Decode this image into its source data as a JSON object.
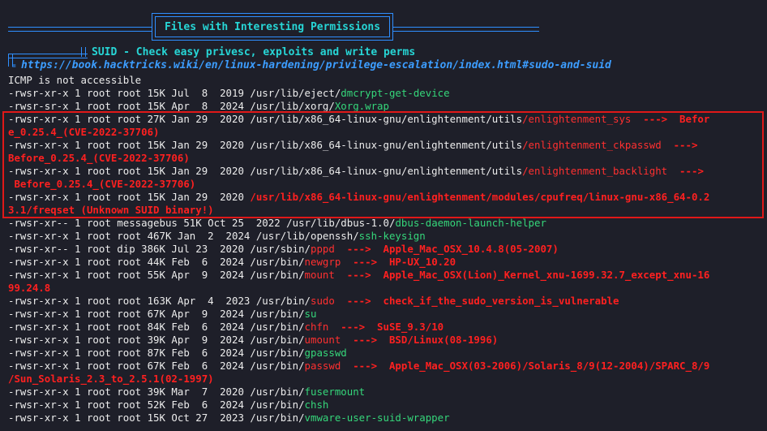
{
  "header": {
    "title": "Files with Interesting Permissions"
  },
  "section": {
    "title": "SUID - Check easy privesc, exploits and write perms",
    "link": "https://book.hacktricks.wiki/en/linux-hardening/privilege-escalation/index.html#sudo-and-suid"
  },
  "lines": [
    "ICMP is not accessible",
    "-rwsr-xr-x 1 root root 15K Jul  8  2019 /usr/lib/eject/",
    "-rwsr-sr-x 1 root root 15K Apr  8  2024 /usr/lib/xorg/",
    "-rwsr-xr-x 1 root root 27K Jan 29  2020 /usr/lib/x86_64-linux-gnu/enlightenment/utils",
    "e_0.25.4_(CVE-2022-37706)",
    "-rwsr-xr-x 1 root root 15K Jan 29  2020 /usr/lib/x86_64-linux-gnu/enlightenment/utils",
    "Before_0.25.4_(CVE-2022-37706)",
    "-rwsr-xr-x 1 root root 15K Jan 29  2020 /usr/lib/x86_64-linux-gnu/enlightenment/utils",
    " Before_0.25.4_(CVE-2022-37706)",
    "-rwsr-xr-x 1 root root 15K Jan 29  2020 ",
    "3.1/freqset (Unknown SUID binary!)",
    "-rwsr-xr-- 1 root messagebus 51K Oct 25  2022 /usr/lib/dbus-1.0/",
    "-rwsr-xr-x 1 root root 467K Jan  2  2024 /usr/lib/openssh/",
    "-rwsr-xr-- 1 root dip 386K Jul 23  2020 /usr/sbin/",
    "-rwsr-xr-x 1 root root 44K Feb  6  2024 /usr/bin/",
    "-rwsr-xr-x 1 root root 55K Apr  9  2024 /usr/bin/",
    "99.24.8",
    "-rwsr-xr-x 1 root root 163K Apr  4  2023 /usr/bin/",
    "-rwsr-xr-x 1 root root 67K Apr  9  2024 /usr/bin/",
    "-rwsr-xr-x 1 root root 84K Feb  6  2024 /usr/bin/",
    "-rwsr-xr-x 1 root root 39K Apr  9  2024 /usr/bin/",
    "-rwsr-xr-x 1 root root 87K Feb  6  2024 /usr/bin/",
    "-rwsr-xr-x 1 root root 67K Feb  6  2024 /usr/bin/",
    "/Sun_Solaris_2.3_to_2.5.1(02-1997)",
    "-rwsr-xr-x 1 root root 39K Mar  7  2020 /usr/bin/",
    "-rwsr-xr-x 1 root root 52K Feb  6  2024 /usr/bin/",
    "-rwsr-xr-x 1 root root 15K Oct 27  2023 /usr/bin/"
  ],
  "bins": {
    "dmcrypt": "dmcrypt-get-device",
    "xorg": "Xorg.wrap",
    "esys": "/enlightenment_sys",
    "eck": "/enlightenment_ckpasswd",
    "eback": "/enlightenment_backlight",
    "cpufreq": "/usr/lib/x86_64-linux-gnu/enlightenment/modules/cpufreq/linux-gnu-x86_64-0.2",
    "dbus": "dbus-daemon-launch-helper",
    "keysign": "ssh-keysign",
    "pppd": "pppd",
    "newgrp": "newgrp",
    "mount": "mount",
    "sudo": "sudo",
    "su": "su",
    "chfn": "chfn",
    "umount": "umount",
    "gpasswd": "gpasswd",
    "passwd": "passwd",
    "fusermount": "fusermount",
    "chsh": "chsh",
    "vmware": "vmware-user-suid-wrapper"
  },
  "notes": {
    "esys": "  --->  Befor",
    "eck": "  --->",
    "eback": "  --->",
    "pppd": "  --->  Apple_Mac_OSX_10.4.8(05-2007)",
    "newgrp": "  --->  HP-UX_10.20",
    "mount": "  --->  Apple_Mac_OSX(Lion)_Kernel_xnu-1699.32.7_except_xnu-16",
    "sudo": "  --->  check_if_the_sudo_version_is_vulnerable",
    "chfn": "  --->  SuSE_9.3/10",
    "umount": "  --->  BSD/Linux(08-1996)",
    "passwd": "  --->  Apple_Mac_OSX(03-2006)/Solaris_8/9(12-2004)/SPARC_8/9"
  }
}
